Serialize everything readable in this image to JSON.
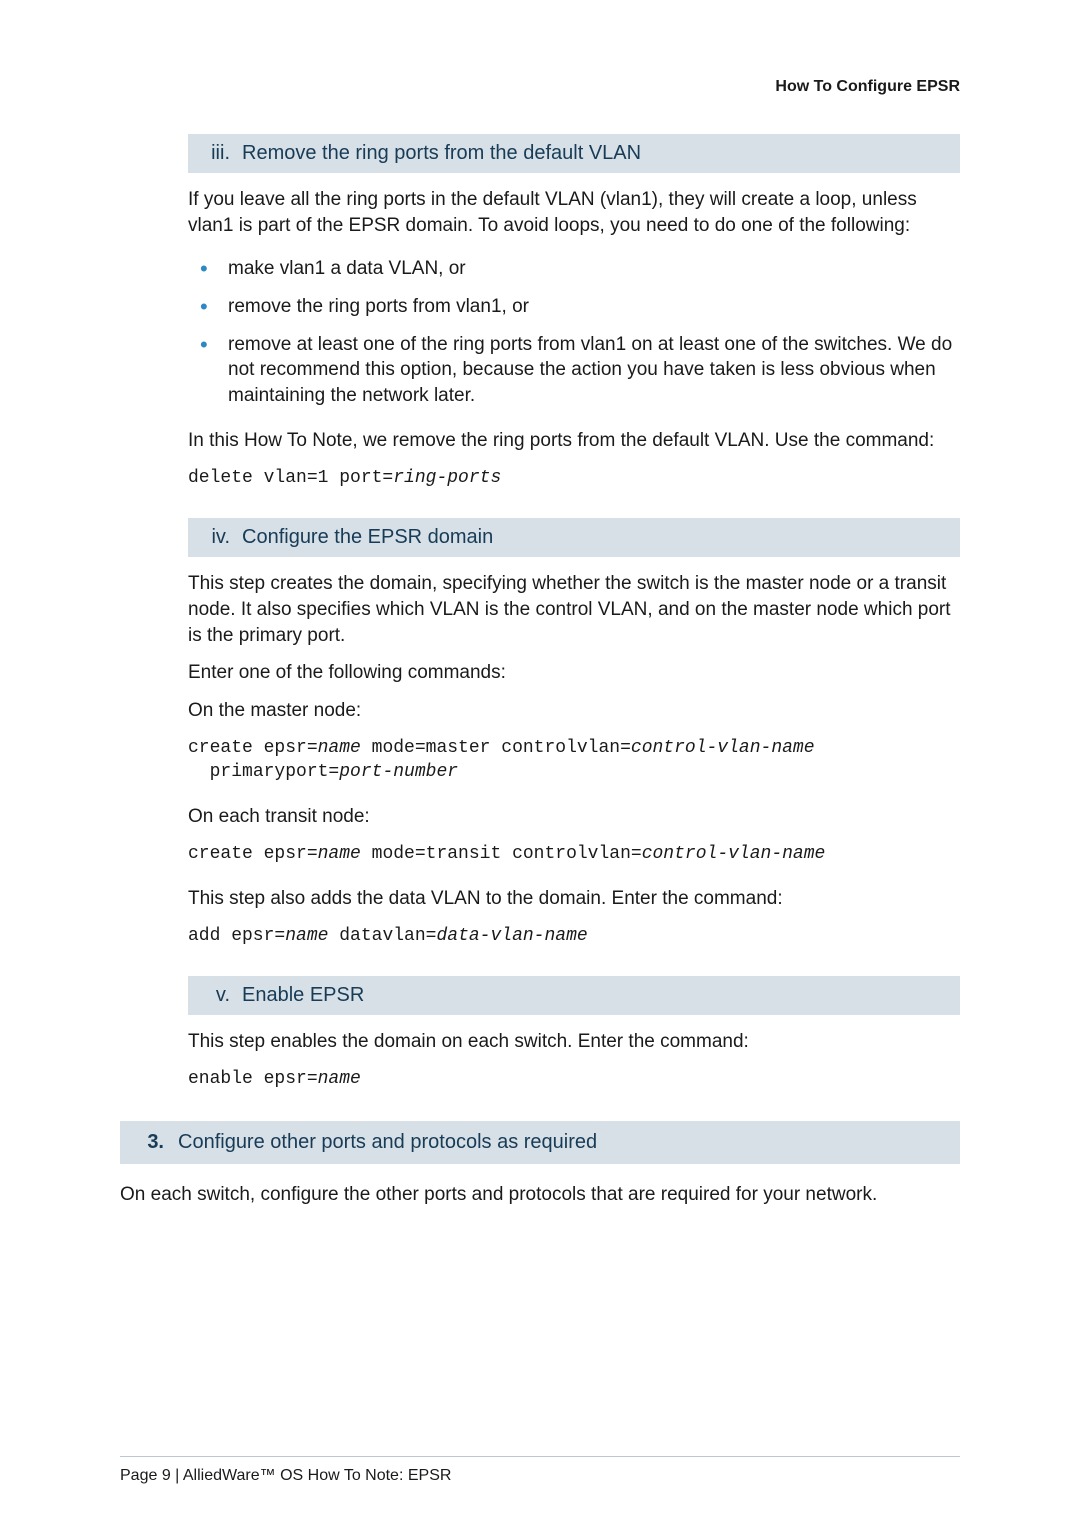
{
  "header": {
    "right": "How To Configure EPSR"
  },
  "stepIII": {
    "num": "iii.",
    "title": "Remove the ring ports from the default VLAN",
    "intro": "If you leave all the ring ports in the default VLAN (vlan1), they will create a loop, unless vlan1 is part of the EPSR domain. To avoid loops, you need to do one of the following:",
    "bullets": [
      "make vlan1 a data VLAN, or",
      "remove the ring ports from vlan1, or",
      "remove at least one of the ring ports from vlan1 on at least one of the switches. We do not recommend this option, because the action you have taken is less obvious when maintaining the network later."
    ],
    "note": "In this How To Note, we remove the ring ports from the default VLAN. Use the command:",
    "code_prefix": "delete vlan=1 port=",
    "code_arg": "ring-ports"
  },
  "stepIV": {
    "num": "iv.",
    "title": "Configure the EPSR domain",
    "intro": "This step creates the domain, specifying whether the switch is the master node or a transit node. It also specifies which VLAN is the control VLAN, and on the master node which port is the primary port.",
    "enter": "Enter one of the following commands:",
    "master_label": "On the master node:",
    "master_code": {
      "p1": "create epsr=",
      "a1": "name",
      "p2": " mode=master controlvlan=",
      "a2": "control-vlan-name",
      "p3": " primaryport=",
      "a3": "port-number",
      "indent": " "
    },
    "transit_label": "On each transit node:",
    "transit_code": {
      "p1": "create epsr=",
      "a1": "name",
      "p2": " mode=transit controlvlan=",
      "a2": "control-vlan-name"
    },
    "adds": "This step also adds the data VLAN to the domain. Enter the command:",
    "add_code": {
      "p1": "add epsr=",
      "a1": "name",
      "p2": " datavlan=",
      "a2": "data-vlan-name"
    }
  },
  "stepV": {
    "num": "v.",
    "title": "Enable EPSR",
    "intro": "This step enables the domain on each switch. Enter the command:",
    "code": {
      "p1": "enable epsr=",
      "a1": "name"
    }
  },
  "section3": {
    "num": "3.",
    "title": "Configure other ports and protocols as required",
    "body": "On each switch, configure the other ports and protocols that are required for your network."
  },
  "footer": "Page 9 | AlliedWare™ OS How To Note: EPSR"
}
